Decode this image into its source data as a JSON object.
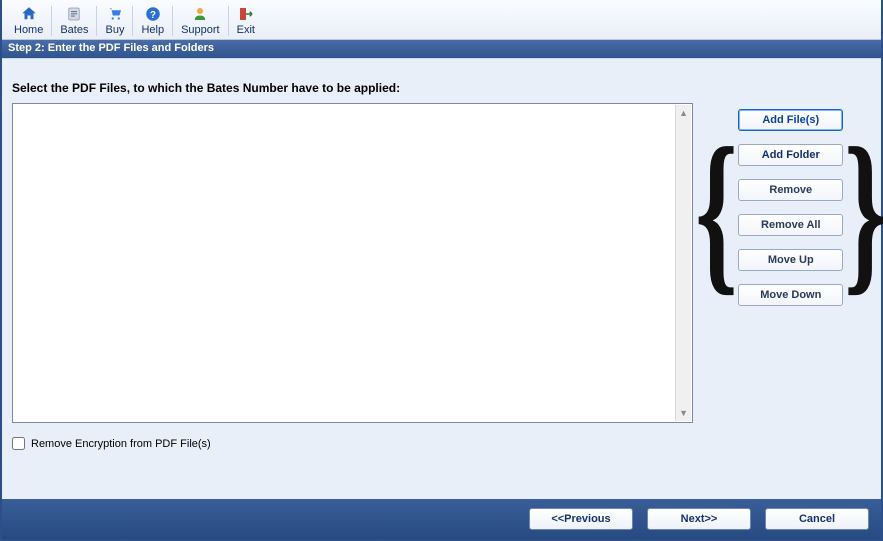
{
  "toolbar": {
    "home": "Home",
    "bates": "Bates",
    "buy": "Buy",
    "help": "Help",
    "support": "Support",
    "exit": "Exit"
  },
  "step_title": "Step 2: Enter the PDF Files and Folders",
  "instruction": "Select the PDF Files, to which the Bates Number have to be applied:",
  "files": [],
  "side_buttons": {
    "add_files": "Add File(s)",
    "add_folder": "Add Folder",
    "remove": "Remove",
    "remove_all": "Remove All",
    "move_up": "Move Up",
    "move_down": "Move Down"
  },
  "checkbox": {
    "label": "Remove Encryption from PDF File(s)",
    "checked": false
  },
  "footer": {
    "previous": "<<Previous",
    "next": "Next>>",
    "cancel": "Cancel"
  }
}
